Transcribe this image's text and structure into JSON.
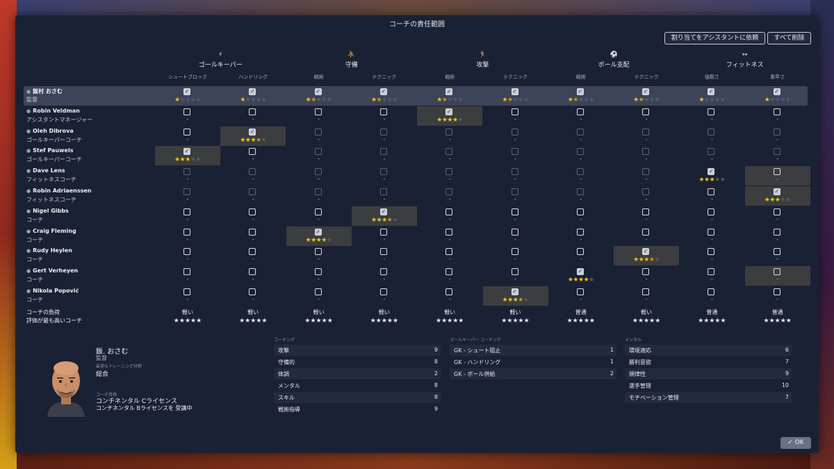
{
  "dialog": {
    "title": "コーチの責任範囲",
    "assign_button": "割り当てをアシスタントに依頼",
    "clear_button": "すべて削除",
    "ok_button": "✓ OK"
  },
  "groups": [
    {
      "label": "ゴールキーパー",
      "icon": "goalkeeper-icon",
      "glyph": "⚡"
    },
    {
      "label": "守備",
      "icon": "defense-icon",
      "glyph": "⛹"
    },
    {
      "label": "攻撃",
      "icon": "attack-icon",
      "glyph": "🏃"
    },
    {
      "label": "ボール支配",
      "icon": "possession-icon",
      "glyph": "⚽"
    },
    {
      "label": "フィットネス",
      "icon": "fitness-icon",
      "glyph": "↔"
    }
  ],
  "subcategories": [
    "シュートブロック",
    "ハンドリング",
    "戦術",
    "テクニック",
    "戦術",
    "テクニック",
    "戦術",
    "テクニック",
    "強靭さ",
    "素早さ"
  ],
  "rows": [
    {
      "name": "飯村 おさむ",
      "role": "監督",
      "selected": true,
      "cells": [
        {
          "state": "on",
          "stars": 1.0
        },
        {
          "state": "on",
          "stars": 1.0
        },
        {
          "state": "on",
          "stars": 1.5
        },
        {
          "state": "on",
          "stars": 1.5
        },
        {
          "state": "on",
          "stars": 1.5
        },
        {
          "state": "on",
          "stars": 1.5
        },
        {
          "state": "on",
          "stars": 1.5
        },
        {
          "state": "on",
          "stars": 1.5
        },
        {
          "state": "on",
          "stars": 1.0
        },
        {
          "state": "on",
          "stars": 1.0
        }
      ]
    },
    {
      "name": "Robin Veldman",
      "role": "アシスタントマネージャー",
      "cells": [
        {
          "state": "off"
        },
        {
          "state": "off"
        },
        {
          "state": "off"
        },
        {
          "state": "off"
        },
        {
          "state": "on",
          "stars": 4.0,
          "hl": true
        },
        {
          "state": "off"
        },
        {
          "state": "off"
        },
        {
          "state": "off"
        },
        {
          "state": "off"
        },
        {
          "state": "off"
        }
      ]
    },
    {
      "name": "Oleh Dibrova",
      "role": "ゴールキーパーコーチ",
      "cells": [
        {
          "state": "off"
        },
        {
          "state": "on",
          "stars": 3.5,
          "hl": true
        },
        {
          "state": "dim"
        },
        {
          "state": "dim"
        },
        {
          "state": "dim"
        },
        {
          "state": "dim"
        },
        {
          "state": "dim"
        },
        {
          "state": "dim"
        },
        {
          "state": "dim"
        },
        {
          "state": "dim"
        }
      ]
    },
    {
      "name": "Stef Pauwels",
      "role": "ゴールキーパーコーチ",
      "cells": [
        {
          "state": "on",
          "stars": 3.0,
          "hl": true
        },
        {
          "state": "off"
        },
        {
          "state": "dim"
        },
        {
          "state": "dim"
        },
        {
          "state": "dim"
        },
        {
          "state": "dim"
        },
        {
          "state": "dim"
        },
        {
          "state": "dim"
        },
        {
          "state": "dim"
        },
        {
          "state": "dim"
        }
      ]
    },
    {
      "name": "Dave Lens",
      "role": "フィットネスコーチ",
      "cells": [
        {
          "state": "dim"
        },
        {
          "state": "dim"
        },
        {
          "state": "dim"
        },
        {
          "state": "dim"
        },
        {
          "state": "dim"
        },
        {
          "state": "dim"
        },
        {
          "state": "dim"
        },
        {
          "state": "dim"
        },
        {
          "state": "on",
          "stars": 3.0
        },
        {
          "state": "off",
          "hl": true
        }
      ]
    },
    {
      "name": "Robin Adriaenssen",
      "role": "フィットネスコーチ",
      "cells": [
        {
          "state": "dim"
        },
        {
          "state": "dim"
        },
        {
          "state": "dim"
        },
        {
          "state": "dim"
        },
        {
          "state": "dim"
        },
        {
          "state": "dim"
        },
        {
          "state": "dim"
        },
        {
          "state": "dim"
        },
        {
          "state": "off"
        },
        {
          "state": "on",
          "stars": 3.0,
          "hl": true
        }
      ]
    },
    {
      "name": "Nigel Gibbs",
      "role": "コーチ",
      "cells": [
        {
          "state": "off"
        },
        {
          "state": "off"
        },
        {
          "state": "off"
        },
        {
          "state": "on",
          "stars": 3.5,
          "hl": true
        },
        {
          "state": "off"
        },
        {
          "state": "off"
        },
        {
          "state": "off"
        },
        {
          "state": "off"
        },
        {
          "state": "off"
        },
        {
          "state": "off"
        }
      ]
    },
    {
      "name": "Craig Fleming",
      "role": "コーチ",
      "cells": [
        {
          "state": "off"
        },
        {
          "state": "off"
        },
        {
          "state": "on",
          "stars": 4.0,
          "hl": true
        },
        {
          "state": "off"
        },
        {
          "state": "off"
        },
        {
          "state": "off"
        },
        {
          "state": "off"
        },
        {
          "state": "off"
        },
        {
          "state": "off"
        },
        {
          "state": "off"
        }
      ]
    },
    {
      "name": "Rudy Heylen",
      "role": "コーチ",
      "cells": [
        {
          "state": "off"
        },
        {
          "state": "off"
        },
        {
          "state": "off"
        },
        {
          "state": "off"
        },
        {
          "state": "off"
        },
        {
          "state": "off"
        },
        {
          "state": "off"
        },
        {
          "state": "on",
          "stars": 3.5,
          "hl": true
        },
        {
          "state": "off"
        },
        {
          "state": "off"
        }
      ]
    },
    {
      "name": "Gert Verheyen",
      "role": "コーチ",
      "cells": [
        {
          "state": "off"
        },
        {
          "state": "off"
        },
        {
          "state": "off"
        },
        {
          "state": "off"
        },
        {
          "state": "off"
        },
        {
          "state": "off"
        },
        {
          "state": "on",
          "stars": 4.0
        },
        {
          "state": "off"
        },
        {
          "state": "off"
        },
        {
          "state": "off",
          "hl": true
        }
      ]
    },
    {
      "name": "Nikola Popović",
      "role": "コーチ",
      "cells": [
        {
          "state": "off"
        },
        {
          "state": "off"
        },
        {
          "state": "off"
        },
        {
          "state": "off"
        },
        {
          "state": "off"
        },
        {
          "state": "on",
          "stars": 3.5,
          "hl": true
        },
        {
          "state": "off"
        },
        {
          "state": "off"
        },
        {
          "state": "off"
        },
        {
          "state": "off"
        }
      ]
    }
  ],
  "summary": {
    "load_label": "コーチの負荷",
    "best_label": "評価が最も高いコーチ",
    "loads": [
      "軽い",
      "軽い",
      "軽い",
      "軽い",
      "軽い",
      "軽い",
      "普通",
      "軽い",
      "普通",
      "普通"
    ],
    "best_stars": [
      3.0,
      3.5,
      4.0,
      3.5,
      4.0,
      3.5,
      4.0,
      3.5,
      3.0,
      3.0
    ]
  },
  "dash": "-",
  "profile": {
    "name": "飯. おさむ",
    "role": "監督",
    "best_area_label": "最適なトレーニング分野",
    "best_area": "総合",
    "license_label": "コーチ資格",
    "license": "コンチネンタル Cライセンス",
    "license_course": "コンチネンタル Bライセンスを 受講中"
  },
  "attributes": {
    "coaching": {
      "title": "コーチング",
      "items": [
        {
          "name": "攻撃",
          "value": "9"
        },
        {
          "name": "守備的",
          "value": "8"
        },
        {
          "name": "体調",
          "value": "2"
        },
        {
          "name": "メンタル",
          "value": "8"
        },
        {
          "name": "スキル",
          "value": "8"
        },
        {
          "name": "戦術指導",
          "value": "9"
        }
      ]
    },
    "gk": {
      "title": "ゴールキーパー コーチング",
      "items": [
        {
          "name": "GK - シュート阻止",
          "value": "1"
        },
        {
          "name": "GK - ハンドリング",
          "value": "1"
        },
        {
          "name": "GK - ボール供給",
          "value": "2"
        }
      ]
    },
    "mental": {
      "title": "メンタル",
      "items": [
        {
          "name": "環境適応",
          "value": "6"
        },
        {
          "name": "勝利意欲",
          "value": "7"
        },
        {
          "name": "規律性",
          "value": "9"
        },
        {
          "name": "選手管理",
          "value": "10"
        },
        {
          "name": "モチベーション管理",
          "value": "7"
        }
      ]
    }
  },
  "colors": {
    "star_full": "#f5c518",
    "star_empty": "#555b6c",
    "panel": "#1b2134",
    "selected_row": "#3d4459"
  }
}
